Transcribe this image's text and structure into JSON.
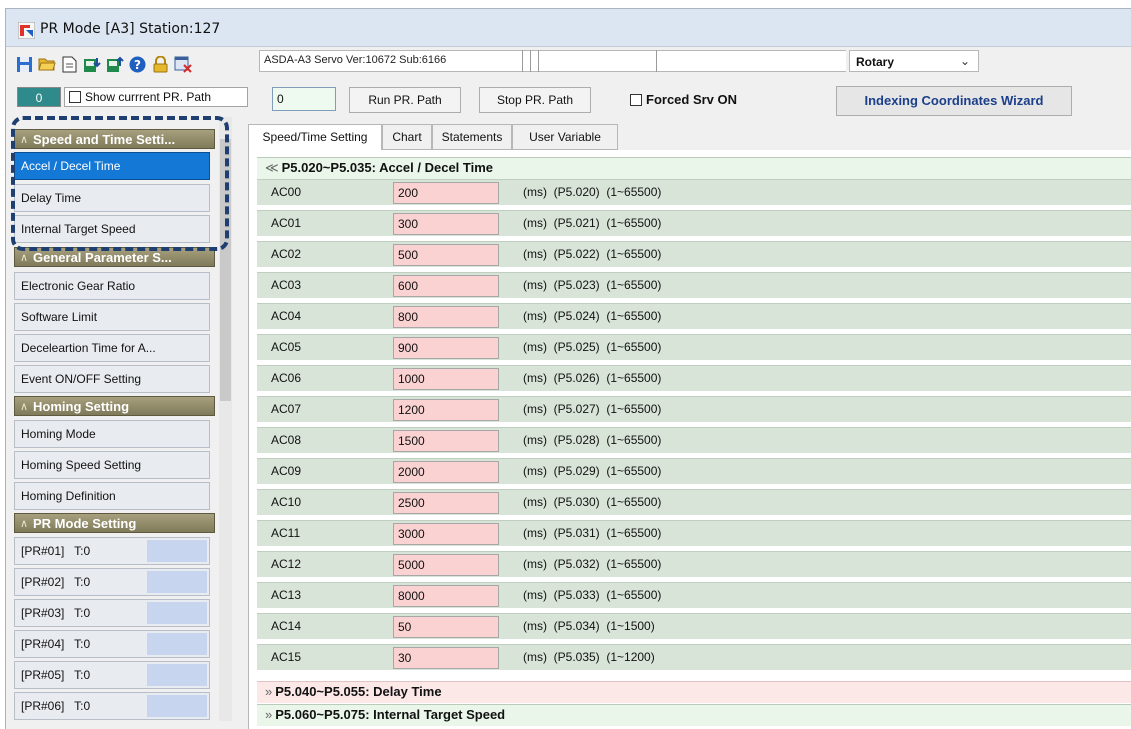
{
  "window": {
    "title": "PR Mode [A3] Station:127"
  },
  "toolbar": {
    "icons": [
      "save-icon",
      "open-folder-icon",
      "document-icon",
      "download-icon",
      "upload-icon",
      "help-icon",
      "lock-icon",
      "close-window-icon"
    ],
    "version_text": "ASDA-A3 Servo Ver:10672 Sub:6166",
    "coordinate_mode": "Rotary"
  },
  "controls": {
    "current_pr": "0",
    "show_path_label": "Show currrent PR. Path",
    "path_input_value": "0",
    "run_button": "Run PR. Path",
    "stop_button": "Stop PR. Path",
    "forced_srv_label": "Forced Srv ON",
    "wizard_button": "Indexing Coordinates Wizard"
  },
  "sidebar": {
    "sections": [
      {
        "title": "Speed and Time Setti...",
        "items": [
          "Accel / Decel Time",
          "Delay Time",
          "Internal Target Speed"
        ]
      },
      {
        "title": "General Parameter S...",
        "items": [
          "Electronic Gear Ratio",
          "Software Limit",
          "Deceleartion Time for A...",
          "Event ON/OFF Setting"
        ]
      },
      {
        "title": "Homing Setting",
        "items": [
          "Homing Mode",
          "Homing Speed Setting",
          "Homing Definition"
        ]
      },
      {
        "title": "PR Mode Setting",
        "items": [
          "[PR#01]   T:0",
          "[PR#02]   T:0",
          "[PR#03]   T:0",
          "[PR#04]   T:0",
          "[PR#05]   T:0",
          "[PR#06]   T:0"
        ]
      }
    ],
    "active_item": "Accel / Decel Time"
  },
  "tabs": [
    "Speed/Time Setting",
    "Chart",
    "Statements",
    "User Variable"
  ],
  "groups": {
    "accel": "P5.020~P5.035: Accel / Decel Time",
    "delay": "P5.040~P5.055: Delay Time",
    "speed": "P5.060~P5.075: Internal Target Speed"
  },
  "rows": [
    {
      "name": "AC00",
      "value": "200",
      "desc": "(ms)  (P5.020)  (1~65500)"
    },
    {
      "name": "AC01",
      "value": "300",
      "desc": "(ms)  (P5.021)  (1~65500)"
    },
    {
      "name": "AC02",
      "value": "500",
      "desc": "(ms)  (P5.022)  (1~65500)"
    },
    {
      "name": "AC03",
      "value": "600",
      "desc": "(ms)  (P5.023)  (1~65500)"
    },
    {
      "name": "AC04",
      "value": "800",
      "desc": "(ms)  (P5.024)  (1~65500)"
    },
    {
      "name": "AC05",
      "value": "900",
      "desc": "(ms)  (P5.025)  (1~65500)"
    },
    {
      "name": "AC06",
      "value": "1000",
      "desc": "(ms)  (P5.026)  (1~65500)"
    },
    {
      "name": "AC07",
      "value": "1200",
      "desc": "(ms)  (P5.027)  (1~65500)"
    },
    {
      "name": "AC08",
      "value": "1500",
      "desc": "(ms)  (P5.028)  (1~65500)"
    },
    {
      "name": "AC09",
      "value": "2000",
      "desc": "(ms)  (P5.029)  (1~65500)"
    },
    {
      "name": "AC10",
      "value": "2500",
      "desc": "(ms)  (P5.030)  (1~65500)"
    },
    {
      "name": "AC11",
      "value": "3000",
      "desc": "(ms)  (P5.031)  (1~65500)"
    },
    {
      "name": "AC12",
      "value": "5000",
      "desc": "(ms)  (P5.032)  (1~65500)"
    },
    {
      "name": "AC13",
      "value": "8000",
      "desc": "(ms)  (P5.033)  (1~65500)"
    },
    {
      "name": "AC14",
      "value": "50",
      "desc": "(ms)  (P5.034)  (1~1500)"
    },
    {
      "name": "AC15",
      "value": "30",
      "desc": "(ms)  (P5.035)  (1~1200)"
    }
  ]
}
